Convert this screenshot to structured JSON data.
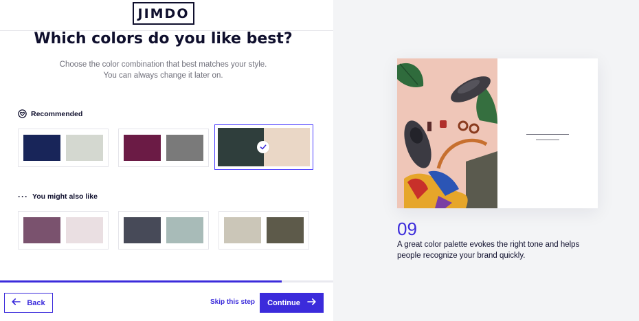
{
  "brand": {
    "logo_text": "JIMDO"
  },
  "page": {
    "title": "Which colors do you like best?",
    "subtitle_lines": [
      "Choose the color combination that best matches your style.",
      "You can always change it later on."
    ]
  },
  "sections": {
    "recommended": {
      "label": "Recommended",
      "icon": "heart-badge-icon",
      "palettes": [
        {
          "colors": [
            "#182559",
            "#d4d8d0"
          ],
          "selected": false
        },
        {
          "colors": [
            "#6b1b45",
            "#7a7a7a"
          ],
          "selected": false
        },
        {
          "colors": [
            "#2f3e3c",
            "#ead7c6"
          ],
          "selected": true
        }
      ]
    },
    "more": {
      "label": "You might also like",
      "icon": "more-dots-icon",
      "palettes": [
        {
          "colors": [
            "#7a526e",
            "#eadfe2"
          ],
          "selected": false
        },
        {
          "colors": [
            "#474a58",
            "#a8bbb8"
          ],
          "selected": false
        },
        {
          "colors": [
            "#cbc6b8",
            "#5d5a4a"
          ],
          "selected": false
        }
      ]
    }
  },
  "progress": {
    "fraction": 0.845,
    "color": "#3b2bdb"
  },
  "footer": {
    "back_label": "Back",
    "skip_label": "Skip this step",
    "continue_label": "Continue"
  },
  "tip": {
    "number": "09",
    "description": "A great color palette evokes the right tone and helps people recognize your brand quickly."
  },
  "colors": {
    "accent": "#3b2bdb",
    "text": "#0f0f2d",
    "right_bg": "#f3f4f6"
  }
}
